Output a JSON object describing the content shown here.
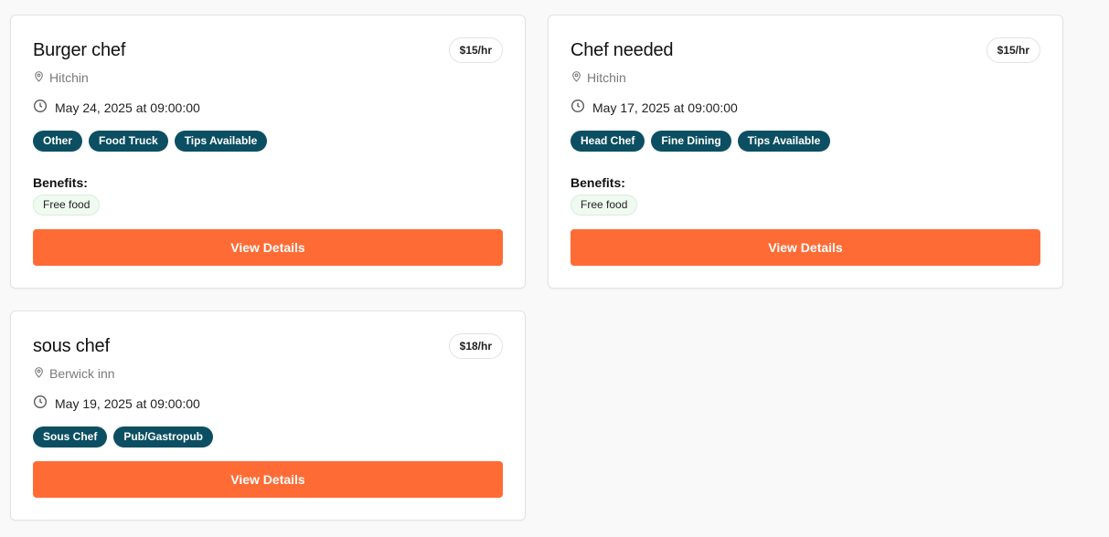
{
  "jobs": [
    {
      "title": "Burger chef",
      "rate": "$15/hr",
      "location": "Hitchin",
      "datetime": "May 24, 2025 at 09:00:00",
      "tags": [
        "Other",
        "Food Truck",
        "Tips Available"
      ],
      "benefits_label": "Benefits:",
      "benefits": [
        "Free food"
      ],
      "button_label": "View Details"
    },
    {
      "title": "Chef needed",
      "rate": "$15/hr",
      "location": "Hitchin",
      "datetime": "May 17, 2025 at 09:00:00",
      "tags": [
        "Head Chef",
        "Fine Dining",
        "Tips Available"
      ],
      "benefits_label": "Benefits:",
      "benefits": [
        "Free food"
      ],
      "button_label": "View Details"
    },
    {
      "title": "sous chef",
      "rate": "$18/hr",
      "location": "Berwick inn",
      "datetime": "May 19, 2025 at 09:00:00",
      "tags": [
        "Sous Chef",
        "Pub/Gastropub"
      ],
      "button_label": "View Details"
    }
  ],
  "icons": {
    "location": "map-pin-icon",
    "time": "clock-icon"
  },
  "colors": {
    "tag_bg": "#0c4f63",
    "button_bg": "#ff6b35",
    "benefit_bg": "#effaf1"
  }
}
